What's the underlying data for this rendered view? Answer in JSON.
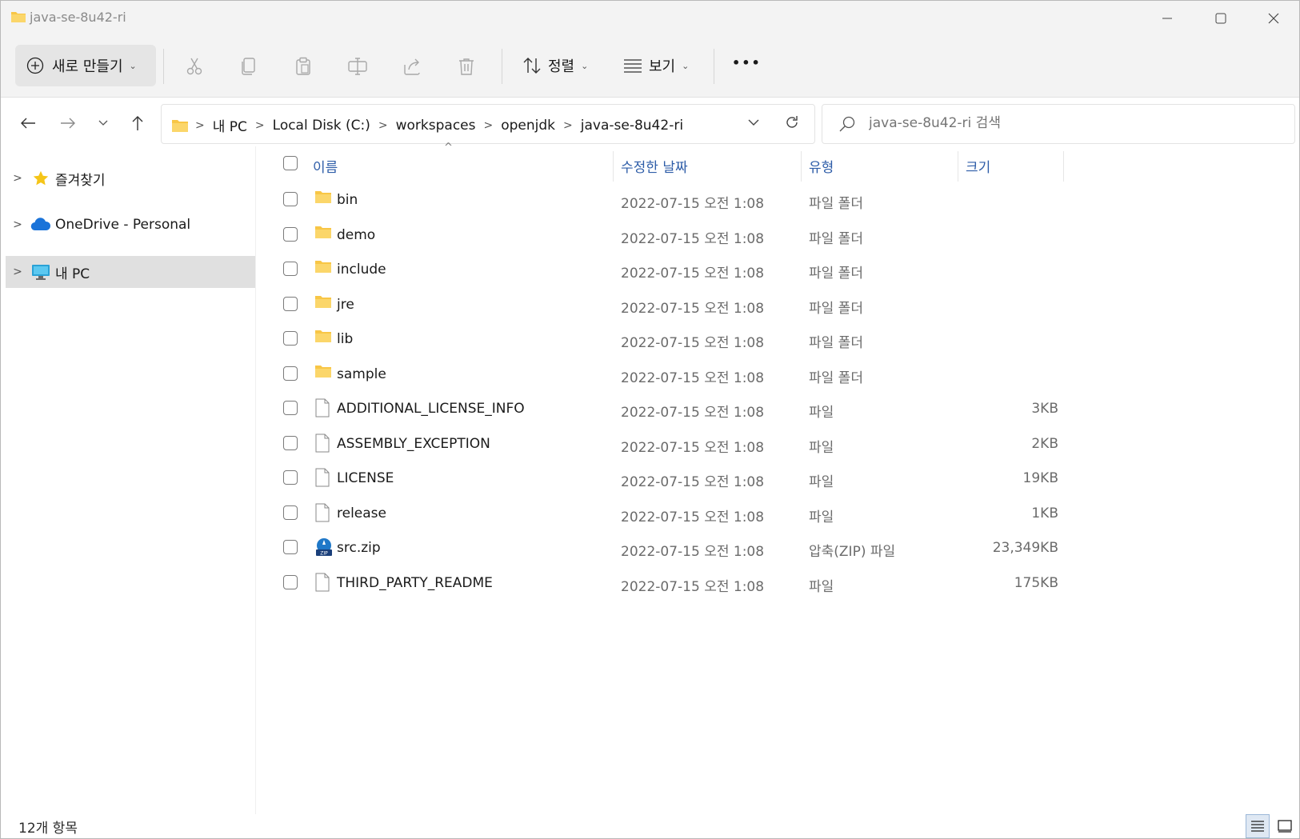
{
  "window": {
    "title": "java-se-8u42-ri"
  },
  "toolbar": {
    "new_label": "새로 만들기",
    "sort_label": "정렬",
    "view_label": "보기",
    "more_label": "•••"
  },
  "address": {
    "crumbs": [
      "내 PC",
      "Local Disk (C:)",
      "workspaces",
      "openjdk",
      "java-se-8u42-ri"
    ]
  },
  "search": {
    "placeholder": "java-se-8u42-ri 검색"
  },
  "sidebar": {
    "items": [
      {
        "label": "즐겨찾기",
        "icon": "star-icon"
      },
      {
        "label": "OneDrive - Personal",
        "icon": "cloud-icon"
      },
      {
        "label": "내 PC",
        "icon": "monitor-icon",
        "selected": true
      }
    ]
  },
  "columns": {
    "name": "이름",
    "date": "수정한 날짜",
    "type": "유형",
    "size": "크기"
  },
  "files": [
    {
      "name": "bin",
      "date": "2022-07-15 오전 1:08",
      "type": "파일 폴더",
      "size": "",
      "icon": "folder-icon"
    },
    {
      "name": "demo",
      "date": "2022-07-15 오전 1:08",
      "type": "파일 폴더",
      "size": "",
      "icon": "folder-icon"
    },
    {
      "name": "include",
      "date": "2022-07-15 오전 1:08",
      "type": "파일 폴더",
      "size": "",
      "icon": "folder-icon"
    },
    {
      "name": "jre",
      "date": "2022-07-15 오전 1:08",
      "type": "파일 폴더",
      "size": "",
      "icon": "folder-icon"
    },
    {
      "name": "lib",
      "date": "2022-07-15 오전 1:08",
      "type": "파일 폴더",
      "size": "",
      "icon": "folder-icon"
    },
    {
      "name": "sample",
      "date": "2022-07-15 오전 1:08",
      "type": "파일 폴더",
      "size": "",
      "icon": "folder-icon"
    },
    {
      "name": "ADDITIONAL_LICENSE_INFO",
      "date": "2022-07-15 오전 1:08",
      "type": "파일",
      "size": "3KB",
      "icon": "file-icon"
    },
    {
      "name": "ASSEMBLY_EXCEPTION",
      "date": "2022-07-15 오전 1:08",
      "type": "파일",
      "size": "2KB",
      "icon": "file-icon"
    },
    {
      "name": "LICENSE",
      "date": "2022-07-15 오전 1:08",
      "type": "파일",
      "size": "19KB",
      "icon": "file-icon"
    },
    {
      "name": "release",
      "date": "2022-07-15 오전 1:08",
      "type": "파일",
      "size": "1KB",
      "icon": "file-icon"
    },
    {
      "name": "src.zip",
      "date": "2022-07-15 오전 1:08",
      "type": "압축(ZIP) 파일",
      "size": "23,349KB",
      "icon": "zip-icon"
    },
    {
      "name": "THIRD_PARTY_README",
      "date": "2022-07-15 오전 1:08",
      "type": "파일",
      "size": "175KB",
      "icon": "file-icon"
    }
  ],
  "status": {
    "count": "12개 항목"
  },
  "colors": {
    "folder": "#f8c646",
    "header_text": "#2e5da8",
    "selected_bg": "#e0e0e0"
  }
}
